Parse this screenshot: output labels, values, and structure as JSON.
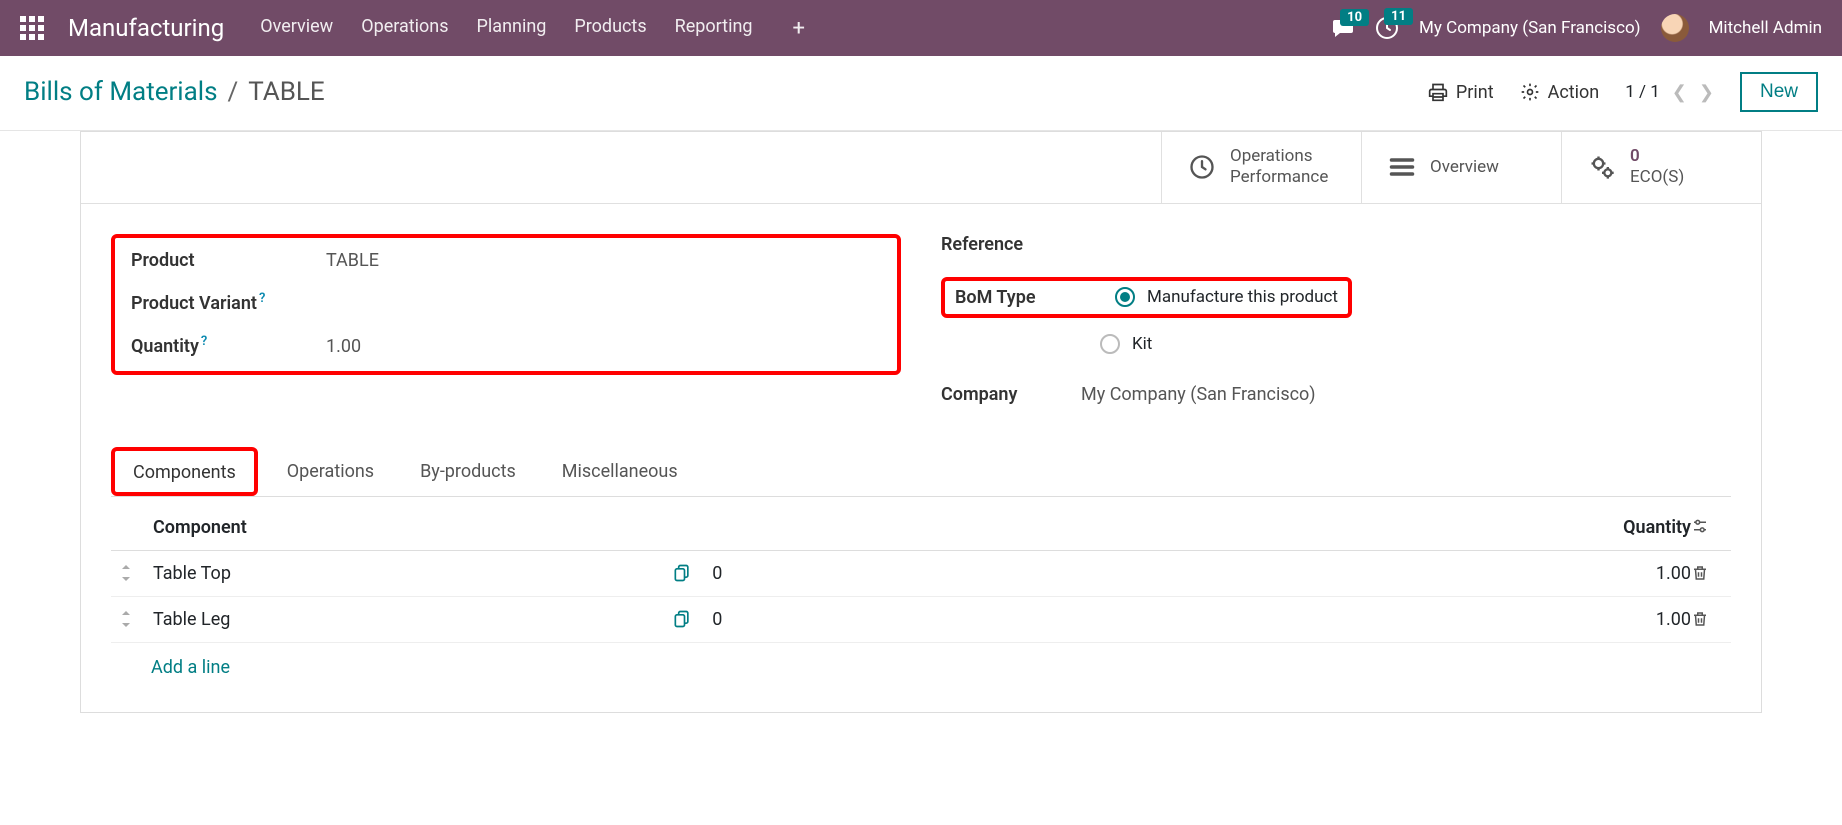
{
  "topnav": {
    "app_title": "Manufacturing",
    "links": [
      "Overview",
      "Operations",
      "Planning",
      "Products",
      "Reporting"
    ],
    "msg_count": "10",
    "activity_count": "11",
    "company": "My Company (San Francisco)",
    "user": "Mitchell Admin"
  },
  "subbar": {
    "breadcrumb_root": "Bills of Materials",
    "breadcrumb_current": "TABLE",
    "print": "Print",
    "action": "Action",
    "pager": "1 / 1",
    "new": "New"
  },
  "stats": {
    "ops_line1": "Operations",
    "ops_line2": "Performance",
    "overview": "Overview",
    "ecos_count": "0",
    "ecos_label": "ECO(S)"
  },
  "form": {
    "left": {
      "product_label": "Product",
      "product_value": "TABLE",
      "variant_label": "Product Variant",
      "qty_label": "Quantity",
      "qty_value": "1.00"
    },
    "right": {
      "reference_label": "Reference",
      "bom_type_label": "BoM Type",
      "bom_opt1": "Manufacture this product",
      "bom_opt2": "Kit",
      "company_label": "Company",
      "company_value": "My Company (San Francisco)"
    }
  },
  "tabs": [
    "Components",
    "Operations",
    "By-products",
    "Miscellaneous"
  ],
  "table": {
    "header_component": "Component",
    "header_quantity": "Quantity",
    "rows": [
      {
        "name": "Table Top",
        "zero": "0",
        "qty": "1.00"
      },
      {
        "name": "Table Leg",
        "zero": "0",
        "qty": "1.00"
      }
    ],
    "add_line": "Add a line"
  }
}
